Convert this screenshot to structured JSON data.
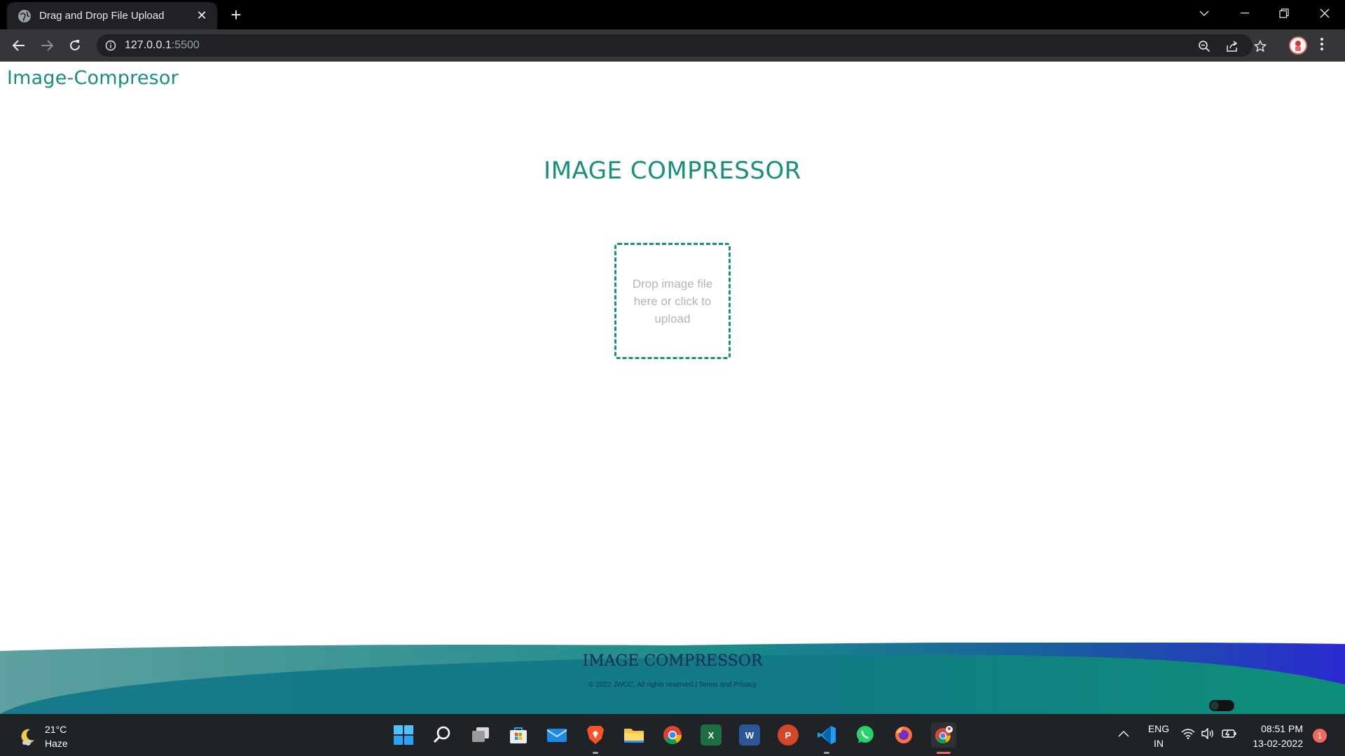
{
  "browser": {
    "tab_title": "Drag and Drop File Upload",
    "new_tab_symbol": "+",
    "url_host": "127.0.0.1",
    "url_port": ":5500"
  },
  "page": {
    "brand": "Image-Compresor",
    "main_title": "IMAGE COMPRESSOR",
    "dropzone_text": "Drop image file here or click to upload",
    "footer_title": "IMAGE COMPRESSOR",
    "footer_copy": "© 2022 JWOC. All rights reserved.| Terms and Privacy"
  },
  "taskbar": {
    "weather_temp": "21°C",
    "weather_desc": "Haze",
    "lang_top": "ENG",
    "lang_bottom": "IN",
    "time": "08:51 PM",
    "date": "13-02-2022",
    "notification_count": "1",
    "apps": [
      "start",
      "search",
      "task-view",
      "store",
      "mail",
      "brave",
      "file-explorer",
      "chrome",
      "excel",
      "word",
      "powerpoint",
      "vscode",
      "whatsapp",
      "firefox",
      "chrome-profile"
    ]
  },
  "colors": {
    "accent": "#178f7a",
    "dropzone_text": "#b4b4b4",
    "footer_dark": "#0c2a4a",
    "browser_frame": "#202124"
  }
}
